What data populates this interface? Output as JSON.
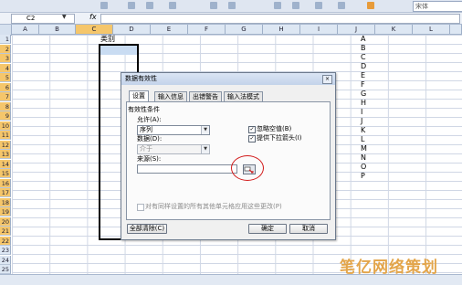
{
  "toolbar": {
    "font_name": "宋体"
  },
  "formula_bar": {
    "name_box": "C2",
    "fx_label": "fx",
    "formula_value": ""
  },
  "columns": [
    "A",
    "B",
    "C",
    "D",
    "E",
    "F",
    "G",
    "H",
    "I",
    "J",
    "K",
    "L"
  ],
  "selected_column": "C",
  "rows": [
    "1",
    "2",
    "3",
    "4",
    "5",
    "6",
    "7",
    "8",
    "9",
    "10",
    "11",
    "12",
    "13",
    "14",
    "15",
    "16",
    "17",
    "18",
    "19",
    "20",
    "21",
    "22",
    "23",
    "24",
    "25"
  ],
  "cells": {
    "C1": "类别"
  },
  "list_values": [
    "A",
    "B",
    "C",
    "D",
    "E",
    "F",
    "G",
    "H",
    "I",
    "J",
    "K",
    "L",
    "M",
    "N",
    "O",
    "P"
  ],
  "dialog": {
    "title": "数据有效性",
    "close_label": "×",
    "tabs": [
      "设置",
      "输入信息",
      "出错警告",
      "输入法模式"
    ],
    "active_tab": "设置",
    "section_label": "有效性条件",
    "allow_label": "允许(A):",
    "allow_value": "序列",
    "data_label": "数据(D):",
    "data_value": "介于",
    "source_label": "来源(S):",
    "source_value": "",
    "ignore_blank_label": "忽略空值(B)",
    "ignore_blank_checked": true,
    "dropdown_label": "提供下拉箭头(I)",
    "dropdown_checked": true,
    "apply_all_label": "对有同样设置的所有其他单元格应用这些更改(P)",
    "apply_all_checked": false,
    "clear_all_label": "全部清除(C)",
    "ok_label": "确定",
    "cancel_label": "取消"
  },
  "watermark": "笔亿网络策划",
  "colors": {
    "selection_header": "#f5c66b",
    "annotation_circle": "#d21b1b",
    "watermark": "#e3a54a"
  }
}
